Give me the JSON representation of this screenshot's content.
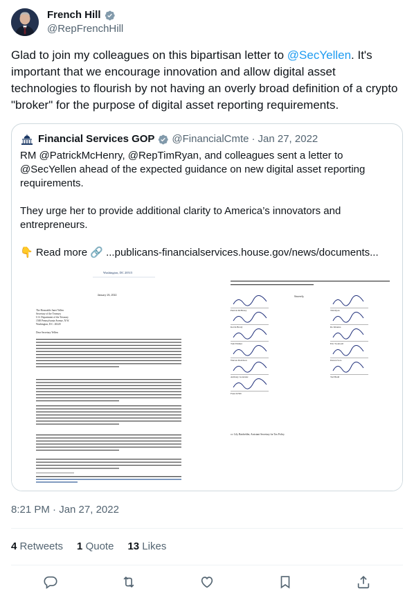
{
  "author": {
    "display_name": "French Hill",
    "handle": "@RepFrenchHill",
    "verified_icon": "verified-badge-icon"
  },
  "tweet": {
    "text_before": "Glad to join my colleagues on this bipartisan letter to ",
    "mention": "@SecYellen",
    "text_after": ". It's important that we encourage innovation and allow digital asset technologies to flourish by not having an overly broad definition of a crypto \"broker\" for the purpose of digital asset reporting requirements."
  },
  "quote": {
    "display_name": "Financial Services GOP",
    "handle": "@FinancialCmte",
    "separator": "·",
    "date": "Jan 27, 2022",
    "para1": "RM @PatrickMcHenry, @RepTimRyan, and colleagues sent a letter to @SecYellen ahead of the expected guidance on new digital asset reporting requirements.",
    "para2": "They urge her to provide additional clarity to America’s innovators and entrepreneurs.",
    "readmore_emoji": "👇",
    "readmore_label": "Read more",
    "link_emoji": "🔗",
    "link_text": "...publicans-financialservices.house.gov/news/documents...",
    "letter": {
      "letterhead": "Washington, DC 20515",
      "date": "January 26, 2022",
      "address": [
        "The Honorable Janet Yellen",
        "Secretary of the Treasury",
        "U.S. Department of the Treasury",
        "1500 Pennsylvania Avenue, N.W.",
        "Washington, D.C. 20220"
      ],
      "salutation": "Dear Secretary Yellen:",
      "closing": "Sincerely,",
      "signers_left": [
        "Patrick McHenry",
        "Kevin Brady",
        "Tom Emmer",
        "Warren Davidson",
        "Anthony Gonzalez",
        "French Hill"
      ],
      "signers_right": [
        "Tim Ryan",
        "Ro Khanna",
        "Eric Swalwell",
        "Darren Soto",
        "Ted Budd"
      ],
      "cc": "cc: Lily Batchelder, Assistant Secretary for Tax Policy"
    }
  },
  "timestamp": "8:21 PM · Jan 27, 2022",
  "stats": {
    "retweets_count": "4",
    "retweets_label": "Retweets",
    "quotes_count": "1",
    "quotes_label": "Quote",
    "likes_count": "13",
    "likes_label": "Likes"
  },
  "actions": {
    "reply_icon": "reply-icon",
    "retweet_icon": "retweet-icon",
    "like_icon": "heart-icon",
    "bookmark_icon": "bookmark-icon",
    "share_icon": "share-icon"
  },
  "colors": {
    "accent": "#1d9bf0",
    "secondary_text": "#536471",
    "border": "#cfd9de"
  }
}
